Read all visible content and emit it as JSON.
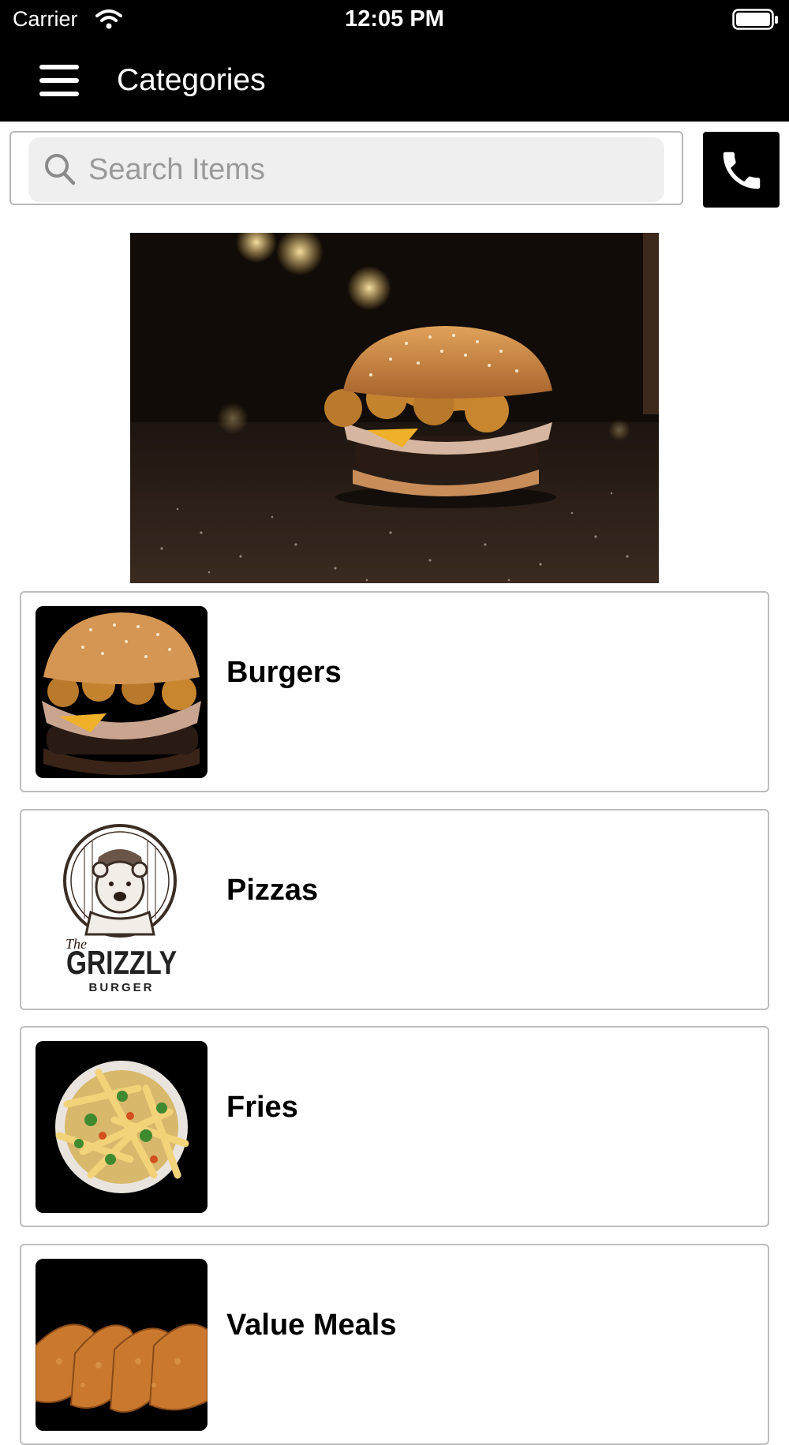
{
  "status": {
    "carrier": "Carrier",
    "time": "12:05 PM"
  },
  "header": {
    "title": "Categories"
  },
  "search": {
    "placeholder": "Search Items"
  },
  "logo": {
    "text_the": "The",
    "text_grizzly": "GRIZZLY",
    "text_burger": "BURGER"
  },
  "categories": [
    {
      "label": "Burgers"
    },
    {
      "label": "Pizzas"
    },
    {
      "label": "Fries"
    },
    {
      "label": "Value Meals"
    }
  ],
  "colors": {
    "bar": "#000000",
    "card_border": "#bdbdbd",
    "search_bg": "#efefef"
  },
  "icons": [
    "wifi-icon",
    "battery-icon",
    "menu-icon",
    "search-icon",
    "phone-icon"
  ]
}
